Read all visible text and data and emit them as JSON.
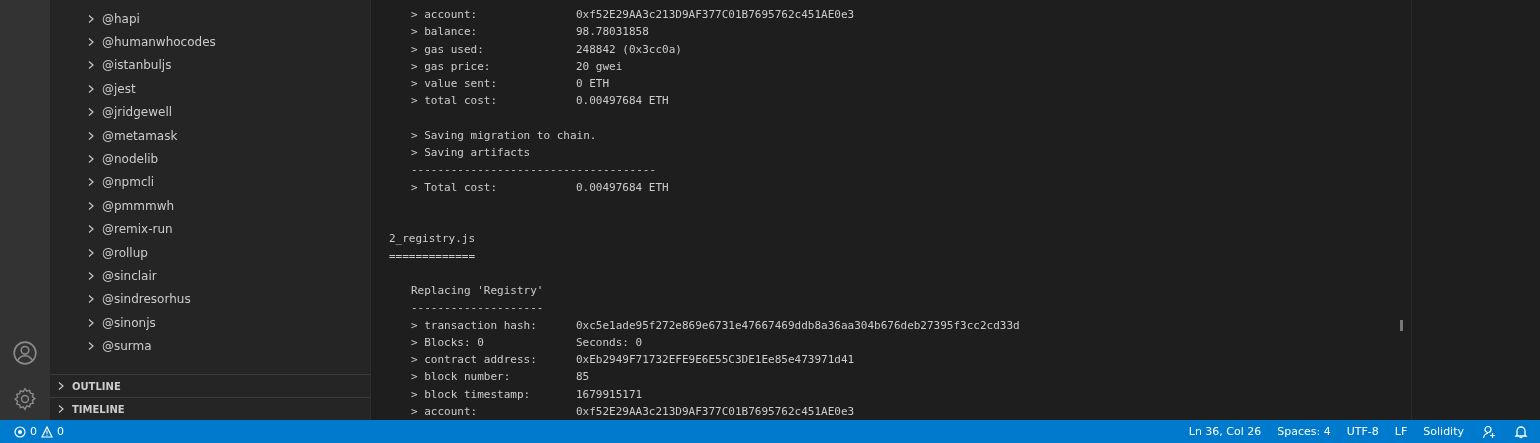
{
  "sidebar": {
    "items": [
      {
        "label": "@hapi",
        "expanded": false
      },
      {
        "label": "@humanwhocodes",
        "expanded": false
      },
      {
        "label": "@istanbuljs",
        "expanded": false
      },
      {
        "label": "@jest",
        "expanded": false
      },
      {
        "label": "@jridgewell",
        "expanded": false
      },
      {
        "label": "@metamask",
        "expanded": false
      },
      {
        "label": "@nodelib",
        "expanded": false
      },
      {
        "label": "@npmcli",
        "expanded": false
      },
      {
        "label": "@pmmmwh",
        "expanded": false
      },
      {
        "label": "@remix-run",
        "expanded": false
      },
      {
        "label": "@rollup",
        "expanded": false
      },
      {
        "label": "@sinclair",
        "expanded": false
      },
      {
        "label": "@sindresorhus",
        "expanded": false
      },
      {
        "label": "@sinonjs",
        "expanded": false
      },
      {
        "label": "@surma",
        "expanded": false
      }
    ],
    "sections": [
      {
        "label": "OUTLINE",
        "expanded": false
      },
      {
        "label": "TIMELINE",
        "expanded": false
      }
    ]
  },
  "terminal": {
    "lines": [
      {
        "kind": "entry",
        "label": "> account:",
        "value": "0xf52E29AA3c213D9AF377C01B7695762c451AE0e3"
      },
      {
        "kind": "entry",
        "label": "> balance:",
        "value": "98.78031858"
      },
      {
        "kind": "entry",
        "label": "> gas used:",
        "value": "248842 (0x3cc0a)"
      },
      {
        "kind": "entry",
        "label": "> gas price:",
        "value": "20 gwei"
      },
      {
        "kind": "entry",
        "label": "> value sent:",
        "value": "0 ETH"
      },
      {
        "kind": "entry",
        "label": "> total cost:",
        "value": "0.00497684 ETH"
      },
      {
        "kind": "blank"
      },
      {
        "kind": "text",
        "text": "> Saving migration to chain."
      },
      {
        "kind": "text",
        "text": "> Saving artifacts"
      },
      {
        "kind": "text",
        "text": "-------------------------------------"
      },
      {
        "kind": "entry",
        "label": "> Total cost:",
        "value": "0.00497684 ETH"
      },
      {
        "kind": "blank"
      },
      {
        "kind": "blank"
      },
      {
        "kind": "heading",
        "text": "2_registry.js"
      },
      {
        "kind": "heading",
        "text": "============="
      },
      {
        "kind": "blank"
      },
      {
        "kind": "text",
        "text": "Replacing 'Registry'"
      },
      {
        "kind": "text",
        "text": "--------------------"
      },
      {
        "kind": "entry",
        "label": "> transaction hash:",
        "value": "0xc5e1ade95f272e869e6731e47667469ddb8a36aa304b676deb27395f3cc2cd33d"
      },
      {
        "kind": "entry",
        "label": "> Blocks: 0",
        "value": "Seconds: 0"
      },
      {
        "kind": "entry",
        "label": "> contract address:",
        "value": "0xEb2949F71732EFE9E6E55C3DE1Ee85e473971d41"
      },
      {
        "kind": "entry",
        "label": "> block number:",
        "value": "85"
      },
      {
        "kind": "entry",
        "label": "> block timestamp:",
        "value": "1679915171"
      },
      {
        "kind": "entry",
        "label": "> account:",
        "value": "0xf52E29AA3c213D9AF377C01B7695762c451AE0e3"
      }
    ]
  },
  "status_bar": {
    "errors": "0",
    "warnings": "0",
    "items": [
      "Ln 36, Col 26",
      "Spaces: 4",
      "UTF-8",
      "LF",
      "Solidity"
    ]
  }
}
